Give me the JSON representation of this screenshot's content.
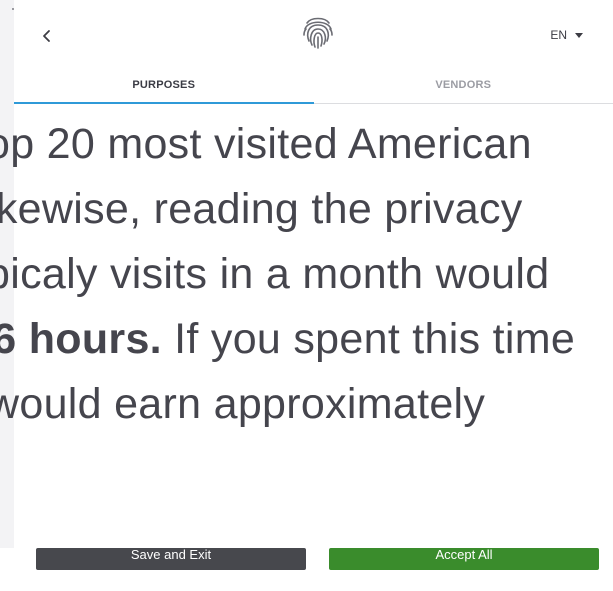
{
  "header": {
    "back_label": "‹",
    "logo_icon": "fingerprint-icon",
    "language": "EN"
  },
  "tabs": [
    {
      "label": "PURPOSES",
      "active": true
    },
    {
      "label": "VENDORS",
      "active": false
    }
  ],
  "body_lines": [
    {
      "text": "op 20 most visited American"
    },
    {
      "text": "ikewise, reading the privacy"
    },
    {
      "text": "picaly visits in a month would"
    },
    {
      "bold": ".6 hours.",
      "text": " If you spent this time"
    },
    {
      "text": " would earn approximately"
    }
  ],
  "footer": {
    "save_label": "Save and Exit",
    "accept_label": "Accept All"
  },
  "colors": {
    "accent_tab": "#2f9ad8",
    "accept": "#3a8c2c",
    "save": "#47484d",
    "text": "#45454d"
  }
}
